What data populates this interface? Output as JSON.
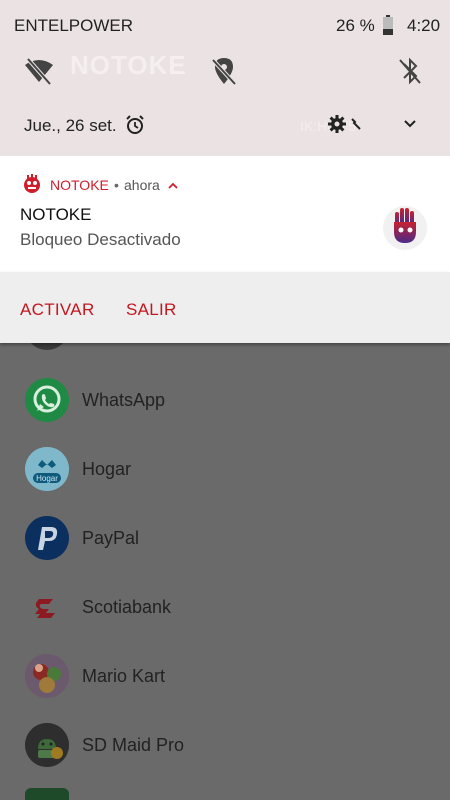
{
  "status_bar": {
    "carrier": "ENTELPOWER",
    "battery_percent": "26 %",
    "time": "4:20"
  },
  "quick_settings": {
    "ghost_title": "NOTOKE",
    "date": "Jue., 26 set.",
    "ghost_mark": "IK:H0.Y5"
  },
  "notification": {
    "app_name": "NOTOKE",
    "separator": "•",
    "time": "ahora",
    "title": "NOTOKE",
    "text": "Bloqueo Desactivado",
    "actions": [
      "ACTIVAR",
      "SALIR"
    ],
    "accent_color": "#d01d2c"
  },
  "app_list": [
    {
      "label": "WhatsApp",
      "icon": "whatsapp-icon",
      "color": "#25d366"
    },
    {
      "label": "Hogar",
      "icon": "hogar-icon",
      "color": "#1a8fb8"
    },
    {
      "label": "PayPal",
      "icon": "paypal-icon",
      "color": "#0a3c7a"
    },
    {
      "label": "Scotiabank",
      "icon": "scotiabank-icon",
      "color": "#d0202e"
    },
    {
      "label": "Mario Kart",
      "icon": "mario-kart-icon",
      "color": "#c83a2a"
    },
    {
      "label": "SD Maid Pro",
      "icon": "sd-maid-icon",
      "color": "#3a3a3a"
    }
  ]
}
